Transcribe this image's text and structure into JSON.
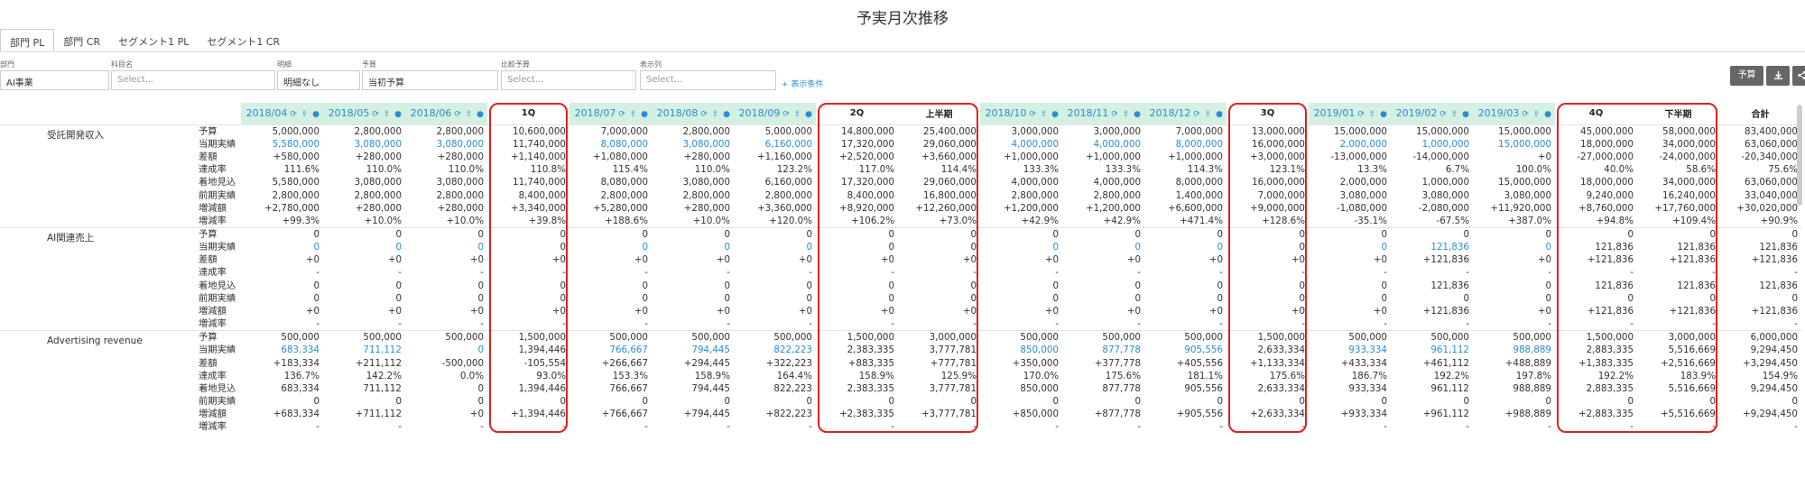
{
  "title": "予実月次推移",
  "tabs": [
    "部門 PL",
    "部門 CR",
    "セグメント1 PL",
    "セグメント1 CR"
  ],
  "filters": [
    {
      "label": "部門",
      "value": "AI事業",
      "placeholder": ""
    },
    {
      "label": "科目名",
      "value": "",
      "placeholder": "Select..."
    },
    {
      "label": "明細",
      "value": "明細なし",
      "placeholder": ""
    },
    {
      "label": "予算",
      "value": "当初予算",
      "placeholder": ""
    },
    {
      "label": "比較予算",
      "value": "",
      "placeholder": "Select..."
    },
    {
      "label": "表示列",
      "value": "",
      "placeholder": "Select..."
    }
  ],
  "add_condition": "+ 表示条件",
  "toolbar": {
    "budget_label": "予算",
    "download_icon": "download-icon",
    "share_icon": "share-icon"
  },
  "columns": [
    "2018/04",
    "2018/05",
    "2018/06",
    "1Q",
    "2018/07",
    "2018/08",
    "2018/09",
    "2Q",
    "上半期",
    "2018/10",
    "2018/11",
    "2018/12",
    "3Q",
    "2019/01",
    "2019/02",
    "2019/03",
    "4Q",
    "下半期",
    "合計"
  ],
  "month_icons": "refresh-icon user-upload-icon user-icon",
  "row_labels": [
    "予算",
    "当期実績",
    "差額",
    "達成率",
    "着地見込",
    "前期実績",
    "増減額",
    "増減率"
  ],
  "sections": [
    {
      "name": "受託開発収入",
      "rows": [
        [
          "5,000,000",
          "2,800,000",
          "2,800,000",
          "10,600,000",
          "7,000,000",
          "2,800,000",
          "5,000,000",
          "14,800,000",
          "25,400,000",
          "3,000,000",
          "3,000,000",
          "7,000,000",
          "13,000,000",
          "15,000,000",
          "15,000,000",
          "15,000,000",
          "45,000,000",
          "58,000,000",
          "83,400,000"
        ],
        [
          "5,580,000",
          "3,080,000",
          "3,080,000",
          "11,740,000",
          "8,080,000",
          "3,080,000",
          "6,160,000",
          "17,320,000",
          "29,060,000",
          "4,000,000",
          "4,000,000",
          "8,000,000",
          "16,000,000",
          "2,000,000",
          "1,000,000",
          "15,000,000",
          "18,000,000",
          "34,000,000",
          "63,060,000"
        ],
        [
          "+580,000",
          "+280,000",
          "+280,000",
          "+1,140,000",
          "+1,080,000",
          "+280,000",
          "+1,160,000",
          "+2,520,000",
          "+3,660,000",
          "+1,000,000",
          "+1,000,000",
          "+1,000,000",
          "+3,000,000",
          "-13,000,000",
          "-14,000,000",
          "+0",
          "-27,000,000",
          "-24,000,000",
          "-20,340,000"
        ],
        [
          "111.6%",
          "110.0%",
          "110.0%",
          "110.8%",
          "115.4%",
          "110.0%",
          "123.2%",
          "117.0%",
          "114.4%",
          "133.3%",
          "133.3%",
          "114.3%",
          "123.1%",
          "13.3%",
          "6.7%",
          "100.0%",
          "40.0%",
          "58.6%",
          "75.6%"
        ],
        [
          "5,580,000",
          "3,080,000",
          "3,080,000",
          "11,740,000",
          "8,080,000",
          "3,080,000",
          "6,160,000",
          "17,320,000",
          "29,060,000",
          "4,000,000",
          "4,000,000",
          "8,000,000",
          "16,000,000",
          "2,000,000",
          "1,000,000",
          "15,000,000",
          "18,000,000",
          "34,000,000",
          "63,060,000"
        ],
        [
          "2,800,000",
          "2,800,000",
          "2,800,000",
          "8,400,000",
          "2,800,000",
          "2,800,000",
          "2,800,000",
          "8,400,000",
          "16,800,000",
          "2,800,000",
          "2,800,000",
          "1,400,000",
          "7,000,000",
          "3,080,000",
          "3,080,000",
          "3,080,000",
          "9,240,000",
          "16,240,000",
          "33,040,000"
        ],
        [
          "+2,780,000",
          "+280,000",
          "+280,000",
          "+3,340,000",
          "+5,280,000",
          "+280,000",
          "+3,360,000",
          "+8,920,000",
          "+12,260,000",
          "+1,200,000",
          "+1,200,000",
          "+6,600,000",
          "+9,000,000",
          "-1,080,000",
          "-2,080,000",
          "+11,920,000",
          "+8,760,000",
          "+17,760,000",
          "+30,020,000"
        ],
        [
          "+99.3%",
          "+10.0%",
          "+10.0%",
          "+39.8%",
          "+188.6%",
          "+10.0%",
          "+120.0%",
          "+106.2%",
          "+73.0%",
          "+42.9%",
          "+42.9%",
          "+471.4%",
          "+128.6%",
          "-35.1%",
          "-67.5%",
          "+387.0%",
          "+94.8%",
          "+109.4%",
          "+90.9%"
        ]
      ]
    },
    {
      "name": "AI関連売上",
      "rows": [
        [
          "0",
          "0",
          "0",
          "0",
          "0",
          "0",
          "0",
          "0",
          "0",
          "0",
          "0",
          "0",
          "0",
          "0",
          "0",
          "0",
          "0",
          "0",
          "0"
        ],
        [
          "0",
          "0",
          "0",
          "0",
          "0",
          "0",
          "0",
          "0",
          "0",
          "0",
          "0",
          "0",
          "0",
          "0",
          "121,836",
          "0",
          "121,836",
          "121,836",
          "121,836"
        ],
        [
          "+0",
          "+0",
          "+0",
          "+0",
          "+0",
          "+0",
          "+0",
          "+0",
          "+0",
          "+0",
          "+0",
          "+0",
          "+0",
          "+0",
          "+121,836",
          "+0",
          "+121,836",
          "+121,836",
          "+121,836"
        ],
        [
          "-",
          "-",
          "-",
          "-",
          "-",
          "-",
          "-",
          "-",
          "-",
          "-",
          "-",
          "-",
          "-",
          "-",
          "-",
          "-",
          "-",
          "-",
          "-"
        ],
        [
          "0",
          "0",
          "0",
          "0",
          "0",
          "0",
          "0",
          "0",
          "0",
          "0",
          "0",
          "0",
          "0",
          "0",
          "121,836",
          "0",
          "121,836",
          "121,836",
          "121,836"
        ],
        [
          "0",
          "0",
          "0",
          "0",
          "0",
          "0",
          "0",
          "0",
          "0",
          "0",
          "0",
          "0",
          "0",
          "0",
          "0",
          "0",
          "0",
          "0",
          "0"
        ],
        [
          "+0",
          "+0",
          "+0",
          "+0",
          "+0",
          "+0",
          "+0",
          "+0",
          "+0",
          "+0",
          "+0",
          "+0",
          "+0",
          "+0",
          "+121,836",
          "+0",
          "+121,836",
          "+121,836",
          "+121,836"
        ],
        [
          "-",
          "-",
          "-",
          "-",
          "-",
          "-",
          "-",
          "-",
          "-",
          "-",
          "-",
          "-",
          "-",
          "-",
          "-",
          "-",
          "-",
          "-",
          "-"
        ]
      ]
    },
    {
      "name": "Advertising revenue",
      "rows": [
        [
          "500,000",
          "500,000",
          "500,000",
          "1,500,000",
          "500,000",
          "500,000",
          "500,000",
          "1,500,000",
          "3,000,000",
          "500,000",
          "500,000",
          "500,000",
          "1,500,000",
          "500,000",
          "500,000",
          "500,000",
          "1,500,000",
          "3,000,000",
          "6,000,000"
        ],
        [
          "683,334",
          "711,112",
          "0",
          "1,394,446",
          "766,667",
          "794,445",
          "822,223",
          "2,383,335",
          "3,777,781",
          "850,000",
          "877,778",
          "905,556",
          "2,633,334",
          "933,334",
          "961,112",
          "988,889",
          "2,883,335",
          "5,516,669",
          "9,294,450"
        ],
        [
          "+183,334",
          "+211,112",
          "-500,000",
          "-105,554",
          "+266,667",
          "+294,445",
          "+322,223",
          "+883,335",
          "+777,781",
          "+350,000",
          "+377,778",
          "+405,556",
          "+1,133,334",
          "+433,334",
          "+461,112",
          "+488,889",
          "+1,383,335",
          "+2,516,669",
          "+3,294,450"
        ],
        [
          "136.7%",
          "142.2%",
          "0.0%",
          "93.0%",
          "153.3%",
          "158.9%",
          "164.4%",
          "158.9%",
          "125.9%",
          "170.0%",
          "175.6%",
          "181.1%",
          "175.6%",
          "186.7%",
          "192.2%",
          "197.8%",
          "192.2%",
          "183.9%",
          "154.9%"
        ],
        [
          "683,334",
          "711,112",
          "0",
          "1,394,446",
          "766,667",
          "794,445",
          "822,223",
          "2,383,335",
          "3,777,781",
          "850,000",
          "877,778",
          "905,556",
          "2,633,334",
          "933,334",
          "961,112",
          "988,889",
          "2,883,335",
          "5,516,669",
          "9,294,450"
        ],
        [
          "0",
          "0",
          "0",
          "0",
          "0",
          "0",
          "0",
          "0",
          "0",
          "0",
          "0",
          "0",
          "0",
          "0",
          "0",
          "0",
          "0",
          "0",
          "0"
        ],
        [
          "+683,334",
          "+711,112",
          "+0",
          "+1,394,446",
          "+766,667",
          "+794,445",
          "+822,223",
          "+2,383,335",
          "+3,777,781",
          "+850,000",
          "+877,778",
          "+905,556",
          "+2,633,334",
          "+933,334",
          "+961,112",
          "+988,889",
          "+2,883,335",
          "+5,516,669",
          "+9,294,450"
        ],
        [
          "-",
          "-",
          "-",
          "-",
          "-",
          "-",
          "-",
          "-",
          "-",
          "-",
          "-",
          "-",
          "-",
          "-",
          "-",
          "-",
          "-",
          "-",
          "-"
        ]
      ]
    }
  ],
  "highlight_colors": {
    "month_header": "#d4f0e2",
    "actual_value": "#2a8dd4",
    "period_outline": "#e02020"
  }
}
